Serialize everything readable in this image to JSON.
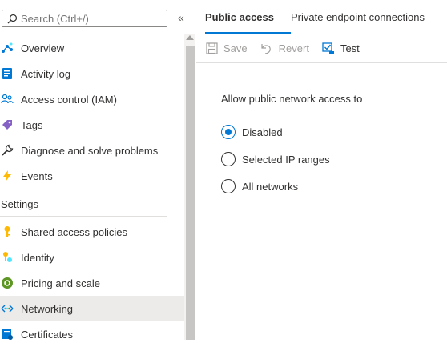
{
  "search": {
    "placeholder": "Search (Ctrl+/)"
  },
  "nav": {
    "items": [
      {
        "label": "Overview",
        "icon": "overview-icon"
      },
      {
        "label": "Activity log",
        "icon": "activity-log-icon"
      },
      {
        "label": "Access control (IAM)",
        "icon": "people-icon"
      },
      {
        "label": "Tags",
        "icon": "tag-icon"
      },
      {
        "label": "Diagnose and solve problems",
        "icon": "wrench-icon"
      },
      {
        "label": "Events",
        "icon": "lightning-icon"
      }
    ],
    "settings_header": "Settings",
    "settings_items": [
      {
        "label": "Shared access policies",
        "icon": "key-icon"
      },
      {
        "label": "Identity",
        "icon": "identity-icon"
      },
      {
        "label": "Pricing and scale",
        "icon": "pricing-icon"
      },
      {
        "label": "Networking",
        "icon": "networking-icon",
        "selected": true
      },
      {
        "label": "Certificates",
        "icon": "certificate-icon"
      }
    ]
  },
  "tabs": [
    {
      "label": "Public access",
      "active": true
    },
    {
      "label": "Private endpoint connections",
      "active": false
    }
  ],
  "toolbar": {
    "save_label": "Save",
    "revert_label": "Revert",
    "test_label": "Test"
  },
  "public_access": {
    "label": "Allow public network access to",
    "options": [
      {
        "label": "Disabled",
        "checked": true
      },
      {
        "label": "Selected IP ranges",
        "checked": false
      },
      {
        "label": "All networks",
        "checked": false
      }
    ]
  },
  "colors": {
    "accent": "#0078d4",
    "selected_bg": "#edebe9",
    "text": "#323130",
    "disabled": "#a19f9d"
  }
}
